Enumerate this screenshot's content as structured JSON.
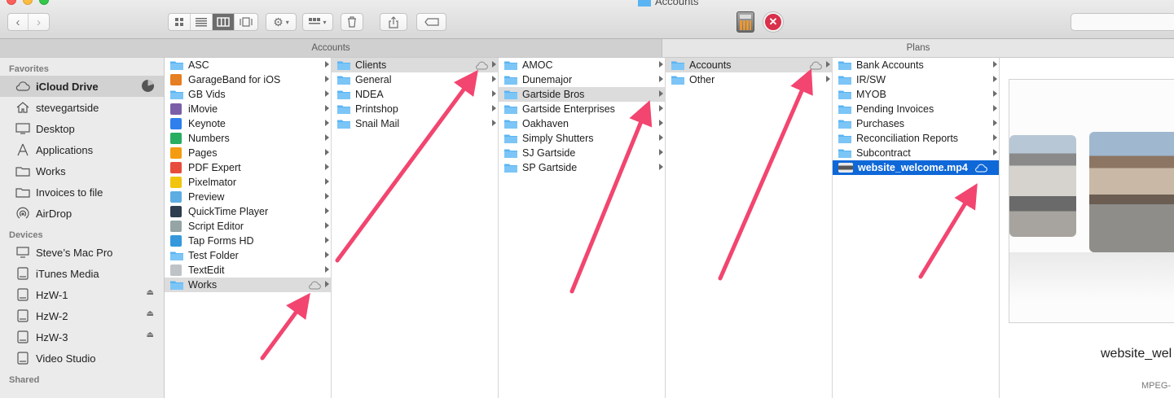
{
  "window": {
    "title": "Accounts",
    "toolbar": {
      "back_icon": "chevron-left-icon",
      "forward_icon": "chevron-right-icon",
      "view_modes": [
        "icon-view-icon",
        "list-view-icon",
        "column-view-icon",
        "cover-flow-icon"
      ],
      "active_view": "column-view-icon",
      "actions": [
        "gear-icon",
        "arrange-icon",
        "trash-icon",
        "share-icon",
        "tag-icon"
      ],
      "app_icons": [
        "calculator-icon",
        "skitch-icon"
      ]
    }
  },
  "path_headers": {
    "left": "Accounts",
    "right": "Plans"
  },
  "sidebar": {
    "sections": [
      {
        "title": "Favorites",
        "items": [
          {
            "label": "iCloud Drive",
            "icon": "icloud-icon",
            "selected": true,
            "extra": "storage-pie-icon"
          },
          {
            "label": "stevegartside",
            "icon": "home-icon"
          },
          {
            "label": "Desktop",
            "icon": "desktop-icon"
          },
          {
            "label": "Applications",
            "icon": "applications-icon"
          },
          {
            "label": "Works",
            "icon": "folder-icon"
          },
          {
            "label": "Invoices to file",
            "icon": "folder-icon"
          },
          {
            "label": "AirDrop",
            "icon": "airdrop-icon"
          }
        ]
      },
      {
        "title": "Devices",
        "items": [
          {
            "label": "Steve’s Mac Pro",
            "icon": "computer-icon"
          },
          {
            "label": "iTunes Media",
            "icon": "disk-icon"
          },
          {
            "label": "HzW-1",
            "icon": "disk-icon",
            "eject": true
          },
          {
            "label": "HzW-2",
            "icon": "disk-icon",
            "eject": true
          },
          {
            "label": "HzW-3",
            "icon": "disk-icon",
            "eject": true
          },
          {
            "label": "Video Studio",
            "icon": "disk-icon"
          }
        ]
      },
      {
        "title": "Shared",
        "items": []
      }
    ]
  },
  "columns": [
    {
      "items": [
        {
          "label": "ASC",
          "icon": "folder"
        },
        {
          "label": "GarageBand for iOS",
          "icon": "app",
          "color": "#e67e22"
        },
        {
          "label": "GB Vids",
          "icon": "folder"
        },
        {
          "label": "iMovie",
          "icon": "app",
          "color": "#7b5ea7"
        },
        {
          "label": "Keynote",
          "icon": "app",
          "color": "#2f80ed"
        },
        {
          "label": "Numbers",
          "icon": "app",
          "color": "#27ae60"
        },
        {
          "label": "Pages",
          "icon": "app",
          "color": "#f39c12"
        },
        {
          "label": "PDF Expert",
          "icon": "app",
          "color": "#e74c3c"
        },
        {
          "label": "Pixelmator",
          "icon": "app",
          "color": "#f1c40f"
        },
        {
          "label": "Preview",
          "icon": "app",
          "color": "#5dade2"
        },
        {
          "label": "QuickTime Player",
          "icon": "app",
          "color": "#2c3e50"
        },
        {
          "label": "Script Editor",
          "icon": "app",
          "color": "#95a5a6"
        },
        {
          "label": "Tap Forms HD",
          "icon": "app",
          "color": "#3498db"
        },
        {
          "label": "Test Folder",
          "icon": "folder"
        },
        {
          "label": "TextEdit",
          "icon": "app",
          "color": "#bdc3c7"
        },
        {
          "label": "Works",
          "icon": "folder",
          "state": "hl",
          "cloud": true
        }
      ]
    },
    {
      "items": [
        {
          "label": "Clients",
          "icon": "folder",
          "state": "hl",
          "cloud": true
        },
        {
          "label": "General",
          "icon": "folder"
        },
        {
          "label": "NDEA",
          "icon": "folder"
        },
        {
          "label": "Printshop",
          "icon": "folder"
        },
        {
          "label": "Snail Mail",
          "icon": "folder"
        }
      ]
    },
    {
      "items": [
        {
          "label": "AMOC",
          "icon": "folder"
        },
        {
          "label": "Dunemajor",
          "icon": "folder"
        },
        {
          "label": "Gartside Bros",
          "icon": "folder",
          "state": "hl"
        },
        {
          "label": "Gartside Enterprises",
          "icon": "folder"
        },
        {
          "label": "Oakhaven",
          "icon": "folder"
        },
        {
          "label": "Simply Shutters",
          "icon": "folder"
        },
        {
          "label": "SJ Gartside",
          "icon": "folder"
        },
        {
          "label": "SP Gartside",
          "icon": "folder"
        }
      ]
    },
    {
      "items": [
        {
          "label": "Accounts",
          "icon": "folder",
          "state": "hl",
          "cloud": true
        },
        {
          "label": "Other",
          "icon": "folder"
        }
      ]
    },
    {
      "items": [
        {
          "label": "Bank Accounts",
          "icon": "folder"
        },
        {
          "label": "IR/SW",
          "icon": "folder"
        },
        {
          "label": "MYOB",
          "icon": "folder"
        },
        {
          "label": "Pending Invoices",
          "icon": "folder"
        },
        {
          "label": "Purchases",
          "icon": "folder"
        },
        {
          "label": "Reconciliation Reports",
          "icon": "folder"
        },
        {
          "label": "Subcontract",
          "icon": "folder"
        },
        {
          "label": "website_welcome.mp4",
          "icon": "video",
          "state": "sel",
          "cloud": true,
          "file": true
        }
      ]
    }
  ],
  "preview": {
    "file_name": "website_wel",
    "kind": "MPEG-"
  },
  "colors": {
    "selection": "#0f68d8",
    "highlight": "#dcdcdc",
    "folder": "#5ab4f3",
    "annotation_arrow": "#f2456f"
  }
}
